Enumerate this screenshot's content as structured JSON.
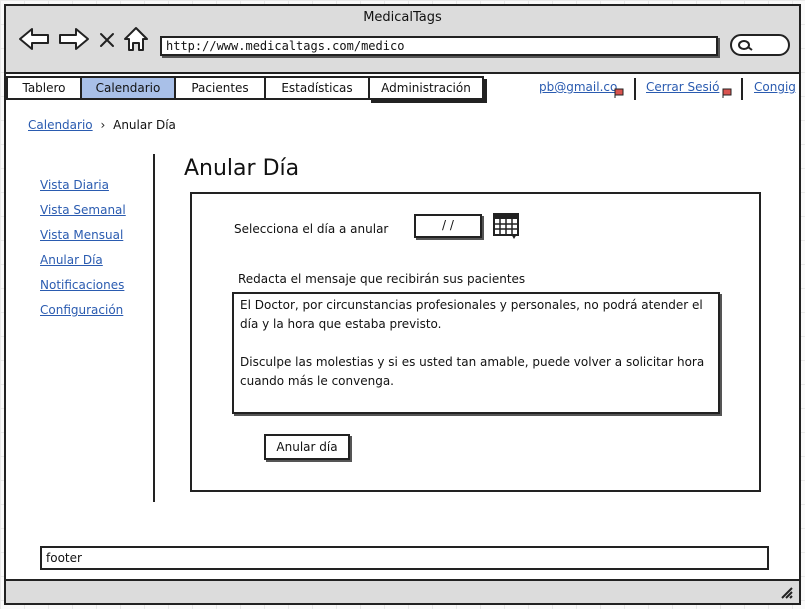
{
  "window": {
    "title": "MedicalTags"
  },
  "browser": {
    "url": "http://www.medicaltags.com/medico",
    "icons": [
      "back-arrow-icon",
      "forward-arrow-icon",
      "close-icon",
      "home-icon",
      "search-icon"
    ]
  },
  "menu": {
    "tabs": [
      {
        "label": "Tablero",
        "active": false
      },
      {
        "label": "Calendario",
        "active": true
      },
      {
        "label": "Pacientes",
        "active": false
      },
      {
        "label": "Estadísticas",
        "active": false
      },
      {
        "label": "Administración",
        "active": false
      }
    ],
    "user_email": "pb@gmail.co",
    "logout": "Cerrar Sesió",
    "config": "Congig",
    "colors": {
      "active_tab": "#a9c0e8",
      "link": "#2a5bb0"
    }
  },
  "breadcrumb": {
    "parent": "Calendario",
    "current": "Anular Día"
  },
  "sidebar": {
    "items": [
      "Vista Diaria",
      "Vista Semanal",
      "Vista Mensual",
      "Anular Día",
      "Notificaciones",
      "Configuración"
    ]
  },
  "main": {
    "title": "Anular Día",
    "day_label": "Selecciona el día a anular",
    "date_value": "/ /",
    "message_label": "Redacta el mensaje que recibirán sus pacientes",
    "message_p1": "El Doctor, por circunstancias profesionales y personales, no podrá atender el día y la hora que estaba previsto.",
    "message_p2": "Disculpe las molestias y si es usted tan amable, puede volver a solicitar hora cuando más le convenga.",
    "button": "Anular día"
  },
  "footer": {
    "text": "footer"
  }
}
